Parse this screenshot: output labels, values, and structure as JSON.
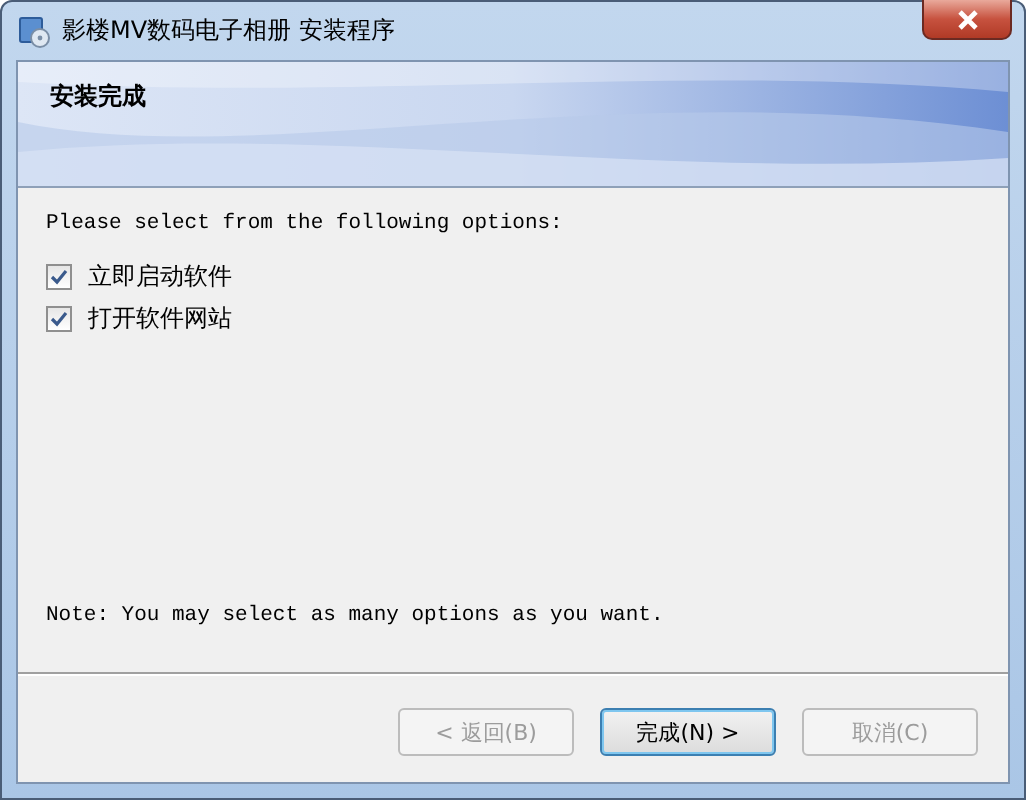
{
  "window": {
    "title": "影楼MV数码电子相册 安装程序"
  },
  "header": {
    "title": "安装完成"
  },
  "prompt": "Please select from the following options:",
  "options": [
    {
      "label": "立即启动软件",
      "checked": true
    },
    {
      "label": "打开软件网站",
      "checked": true
    }
  ],
  "note": "Note: You may select as many options as you want.",
  "buttons": [
    {
      "label": "< 返回(B)",
      "disabled": true,
      "default": false
    },
    {
      "label": "完成(N) >",
      "disabled": false,
      "default": true
    },
    {
      "label": "取消(C)",
      "disabled": true,
      "default": false
    }
  ]
}
